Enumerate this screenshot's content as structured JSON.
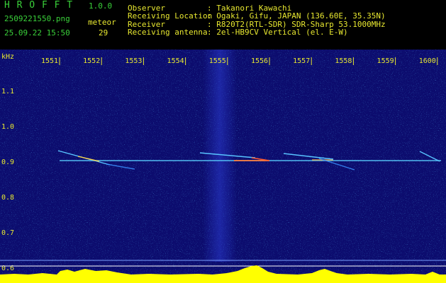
{
  "header": {
    "brand": "H R O F F T",
    "version": "1.0.0",
    "filename": "2509221550.png",
    "datetime": "25.09.22 15:50",
    "meteor_label": "meteor",
    "meteor_count": "29",
    "info": [
      {
        "key": "Observer",
        "value": ": Takanori Kawachi"
      },
      {
        "key": "Receiving Location",
        "value": ": Ogaki, Gifu, JAPAN (136.60E, 35.35N)"
      },
      {
        "key": "Receiver",
        "value": ": R820T2(RTL-SDR) SDR-Sharp 53.1000MHz"
      },
      {
        "key": "Receiving antenna",
        "value": ": 2el-HB9CV Vertical (el. E-W)"
      }
    ]
  },
  "plot": {
    "y_unit": "kHz",
    "y_ticks": [
      "1.1",
      "1.0",
      "0.9",
      "0.8",
      "0.7",
      "0.6"
    ],
    "x_ticks": [
      "1551",
      "1552",
      "1553",
      "1554",
      "1555",
      "1556",
      "1557",
      "1558",
      "1559",
      "1600"
    ],
    "colors": {
      "background": "#0c0c6e",
      "label": "#e8e830",
      "grid": "#3a48c8",
      "histogram": "#00e8ff",
      "peaks": "#ffff00"
    }
  }
}
